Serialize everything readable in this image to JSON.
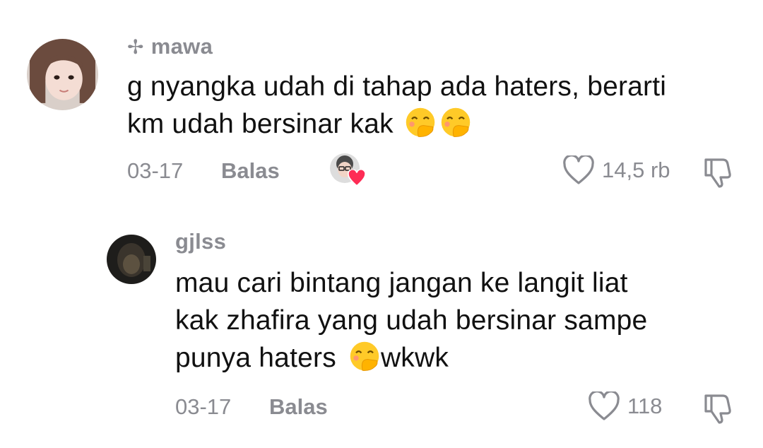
{
  "comments": [
    {
      "username": "mawa",
      "username_prefix": "✢",
      "lines": [
        "g nyangka udah di tahap ada haters, berarti",
        "km udah bersinar kak"
      ],
      "date": "03-17",
      "reply_label": "Balas",
      "likes": "14,5 rb",
      "creator_liked": true
    },
    {
      "username": "gjlss",
      "lines": [
        "mau cari bintang jangan ke langit liat",
        "kak zhafira yang udah bersinar sampe",
        "punya haters",
        "wkwk"
      ],
      "date": "03-17",
      "reply_label": "Balas",
      "likes": "118"
    }
  ],
  "icons": {
    "like": "heart-outline-icon",
    "dislike": "thumbs-down-icon",
    "emoji": "hand-over-mouth-emoji",
    "creator_like": "creator-liked-heart-icon"
  },
  "colors": {
    "heart_badge": "#fe2c55",
    "meta_text": "#8a8b91"
  }
}
